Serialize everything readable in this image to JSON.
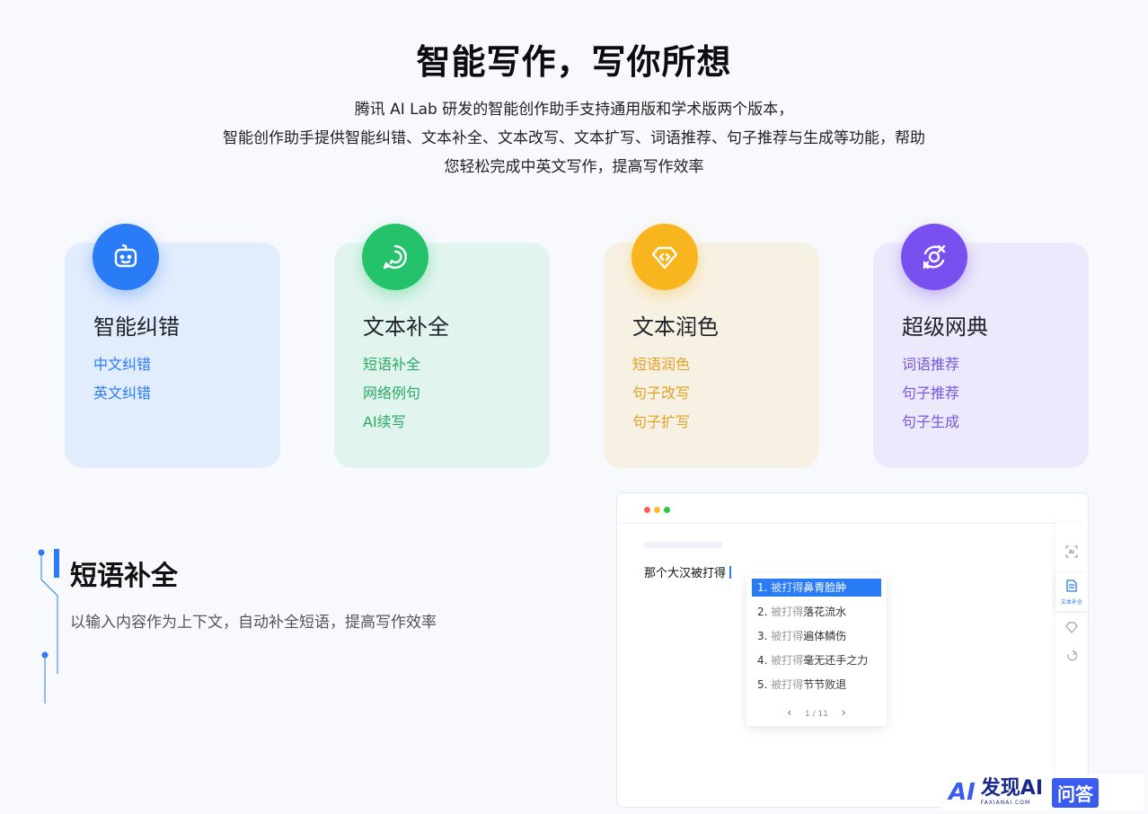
{
  "hero": {
    "title": "智能写作，写你所想",
    "desc_lines": [
      "腾讯 AI Lab 研发的智能创作助手支持通用版和学术版两个版本，",
      "智能创作助手提供智能纠错、文本补全、文本改写、文本扩写、词语推荐、句子推荐与生成等功能，帮助",
      "您轻松完成中英文写作，提高写作效率"
    ]
  },
  "cards": [
    {
      "title": "智能纠错",
      "icon": "robot-face-icon",
      "color": "#2a7bf6",
      "items": [
        "中文纠错",
        "英文纠错"
      ]
    },
    {
      "title": "文本补全",
      "icon": "chat-bubble-icon",
      "color": "#24c36b",
      "items": [
        "短语补全",
        "网络例句",
        "AI续写"
      ]
    },
    {
      "title": "文本润色",
      "icon": "diamond-code-icon",
      "color": "#f8b51d",
      "items": [
        "短语润色",
        "句子改写",
        "句子扩写"
      ]
    },
    {
      "title": "超级网典",
      "icon": "swap-arrows-icon",
      "color": "#7a4ff0",
      "items": [
        "词语推荐",
        "句子推荐",
        "句子生成"
      ]
    }
  ],
  "feature": {
    "title": "短语补全",
    "desc": "以输入内容作为上下文，自动补全短语，提高写作效率"
  },
  "mock": {
    "input_text": "那个大汉被打得",
    "options": [
      {
        "num": "1.",
        "prefix": "被打得",
        "text": "鼻青脸肿",
        "selected": true
      },
      {
        "num": "2.",
        "prefix": "被打得",
        "text": "落花流水",
        "selected": false
      },
      {
        "num": "3.",
        "prefix": "被打得",
        "text": "遍体鳞伤",
        "selected": false
      },
      {
        "num": "4.",
        "prefix": "被打得",
        "text": "毫无还手之力",
        "selected": false
      },
      {
        "num": "5.",
        "prefix": "被打得",
        "text": "节节败退",
        "selected": false
      }
    ],
    "pager": "1 / 11",
    "rail_active_label": "文本补全",
    "window_dot_colors": [
      "#ff5f57",
      "#febc2e",
      "#28c840"
    ]
  },
  "watermark": {
    "ai": "AI",
    "name": "发现AI",
    "domain": "FAXIANAI.COM",
    "qa": "问答"
  }
}
